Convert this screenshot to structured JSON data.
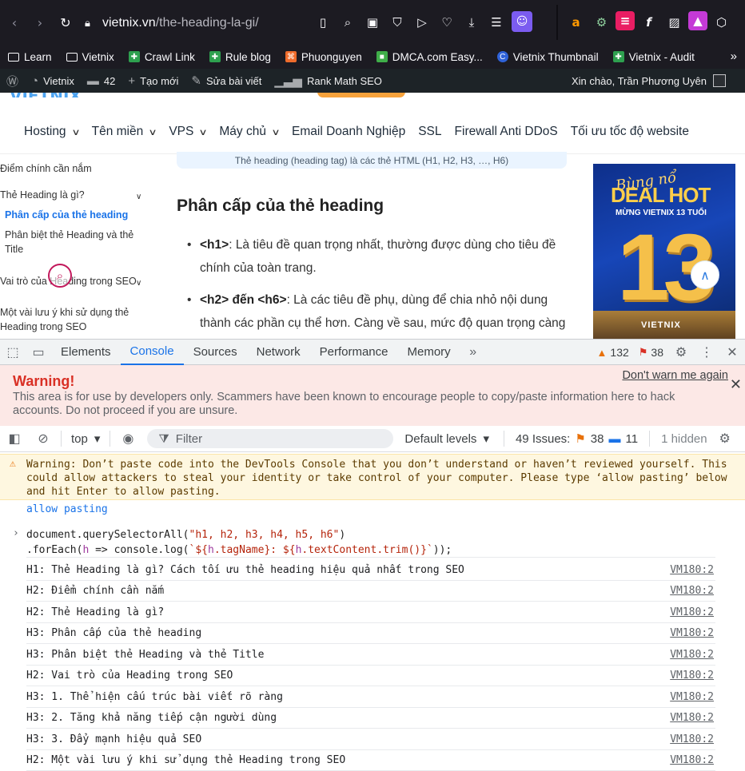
{
  "browser": {
    "url_domain": "vietnix.vn",
    "url_path": "/the-heading-la-gi/",
    "bookmarks": [
      {
        "label": "Learn",
        "icon": "folder-icon"
      },
      {
        "label": "Vietnix",
        "icon": "folder-icon"
      },
      {
        "label": "Crawl Link",
        "icon": "sheets-icon"
      },
      {
        "label": "Rule blog",
        "icon": "sheets-icon"
      },
      {
        "label": "Phuonguyen",
        "icon": "xampp-icon"
      },
      {
        "label": "DMCA.com Easy...",
        "icon": "dmca-icon"
      },
      {
        "label": "Vietnix Thumbnail",
        "icon": "canva-icon"
      },
      {
        "label": "Vietnix - Audit",
        "icon": "sheets-icon"
      }
    ],
    "bookmarks_more": "»"
  },
  "wpbar": {
    "site": "Vietnix",
    "comments": "42",
    "new": "Tạo mới",
    "edit": "Sửa bài viết",
    "seo": "Rank Math SEO",
    "greeting": "Xin chào, Trần Phương Uyên"
  },
  "site": {
    "nav": [
      {
        "label": "Hosting",
        "dropdown": true
      },
      {
        "label": "Tên miền",
        "dropdown": true
      },
      {
        "label": "VPS",
        "dropdown": true
      },
      {
        "label": "Máy chủ",
        "dropdown": true
      },
      {
        "label": "Email Doanh Nghiệp",
        "dropdown": false
      },
      {
        "label": "SSL",
        "dropdown": false
      },
      {
        "label": "Firewall Anti DDoS",
        "dropdown": false
      },
      {
        "label": "Tối ưu tốc độ website",
        "dropdown": false
      }
    ],
    "toc": {
      "item1": "Điểm chính cần nắm",
      "item2": "Thẻ Heading là gì?",
      "item2a": "Phân cấp của thẻ heading",
      "item2b_l1": "Phân biệt thẻ Heading và thẻ",
      "item2b_l2": "Title",
      "item3": "Vai trò của Heading trong SEO",
      "item4_l1": "Một vài lưu ý khi sử dụng thẻ",
      "item4_l2": "Heading trong SEO"
    },
    "image_caption": "Thẻ heading (heading tag) là các thẻ HTML (H1, H2, H3, …, H6)",
    "section_title": "Phân cấp của thẻ heading",
    "bullets": [
      {
        "tag": "<h1>",
        "text": ": Là tiêu đề quan trọng nhất, thường được dùng cho tiêu đề chính của toàn trang."
      },
      {
        "tag": "<h2> đến <h6>",
        "text": ": Là các tiêu đề phụ, dùng để chia nhỏ nội dung thành các phần cụ thể hơn. Càng về sau, mức độ quan trọng càng"
      }
    ],
    "banner": {
      "script": "Bùng nổ",
      "headline": "DEAL HOT",
      "sub": "MỪNG VIETNIX 13 TUỔI",
      "number": "13",
      "brand": "VIETNIX"
    }
  },
  "devtools": {
    "tabs": [
      "Elements",
      "Console",
      "Sources",
      "Network",
      "Performance",
      "Memory"
    ],
    "active_tab": "Console",
    "warnings_count": "132",
    "errors_count": "38",
    "warning_banner": {
      "title": "Warning!",
      "dismiss": "Don't warn me again",
      "text": "This area is for use by developers only. Scammers have been known to encourage people to copy/paste information here to hack accounts. Do not proceed if you are unsure."
    },
    "toolbar": {
      "context": "top",
      "filter_placeholder": "Filter",
      "levels": "Default levels",
      "issues_label": "49 Issues:",
      "issues_errors": "38",
      "issues_info": "11",
      "hidden": "1 hidden"
    },
    "console": {
      "paste_warning": "Warning: Don’t paste code into the DevTools Console that you don’t understand or haven’t reviewed yourself. This could allow attackers to steal your identity or take control of your computer. Please type ‘allow pasting’ below and hit Enter to allow pasting.",
      "echo": "allow pasting",
      "input_line1_pre": "document.querySelectorAll(",
      "input_line1_str": "\"h1, h2, h3, h4, h5, h6\"",
      "input_line1_post": ")",
      "input_line2_pre": ".forEach(",
      "input_line2_var": "h",
      "input_line2_arrow": " => console.log(",
      "input_line2_tpl_a": "`${",
      "input_line2_var2": "h",
      "input_line2_tpl_b": ".tagName}: ${",
      "input_line2_var3": "h",
      "input_line2_tpl_c": ".textContent.trim()}`",
      "input_line2_end": "));",
      "logs": [
        {
          "text": "H1: Thẻ Heading là gì? Cách tối ưu thẻ heading hiệu quả nhất trong SEO",
          "src": "VM180:2"
        },
        {
          "text": "H2: Điểm chính cần nắm",
          "src": "VM180:2"
        },
        {
          "text": "H2: Thẻ Heading là gì?",
          "src": "VM180:2"
        },
        {
          "text": "H3: Phân cấp của thẻ heading",
          "src": "VM180:2"
        },
        {
          "text": "H3: Phân biệt thẻ Heading và thẻ Title",
          "src": "VM180:2"
        },
        {
          "text": "H2: Vai trò của Heading trong SEO",
          "src": "VM180:2"
        },
        {
          "text": "H3: 1. Thể hiện cấu trúc bài viết rõ ràng",
          "src": "VM180:2"
        },
        {
          "text": "H3: 2. Tăng khả năng tiếp cận người dùng",
          "src": "VM180:2"
        },
        {
          "text": "H3: 3. Đẩy mạnh hiệu quả SEO",
          "src": "VM180:2"
        },
        {
          "text": "H2: Một vài lưu ý khi sử dụng thẻ Heading trong SEO",
          "src": "VM180:2"
        }
      ]
    }
  }
}
